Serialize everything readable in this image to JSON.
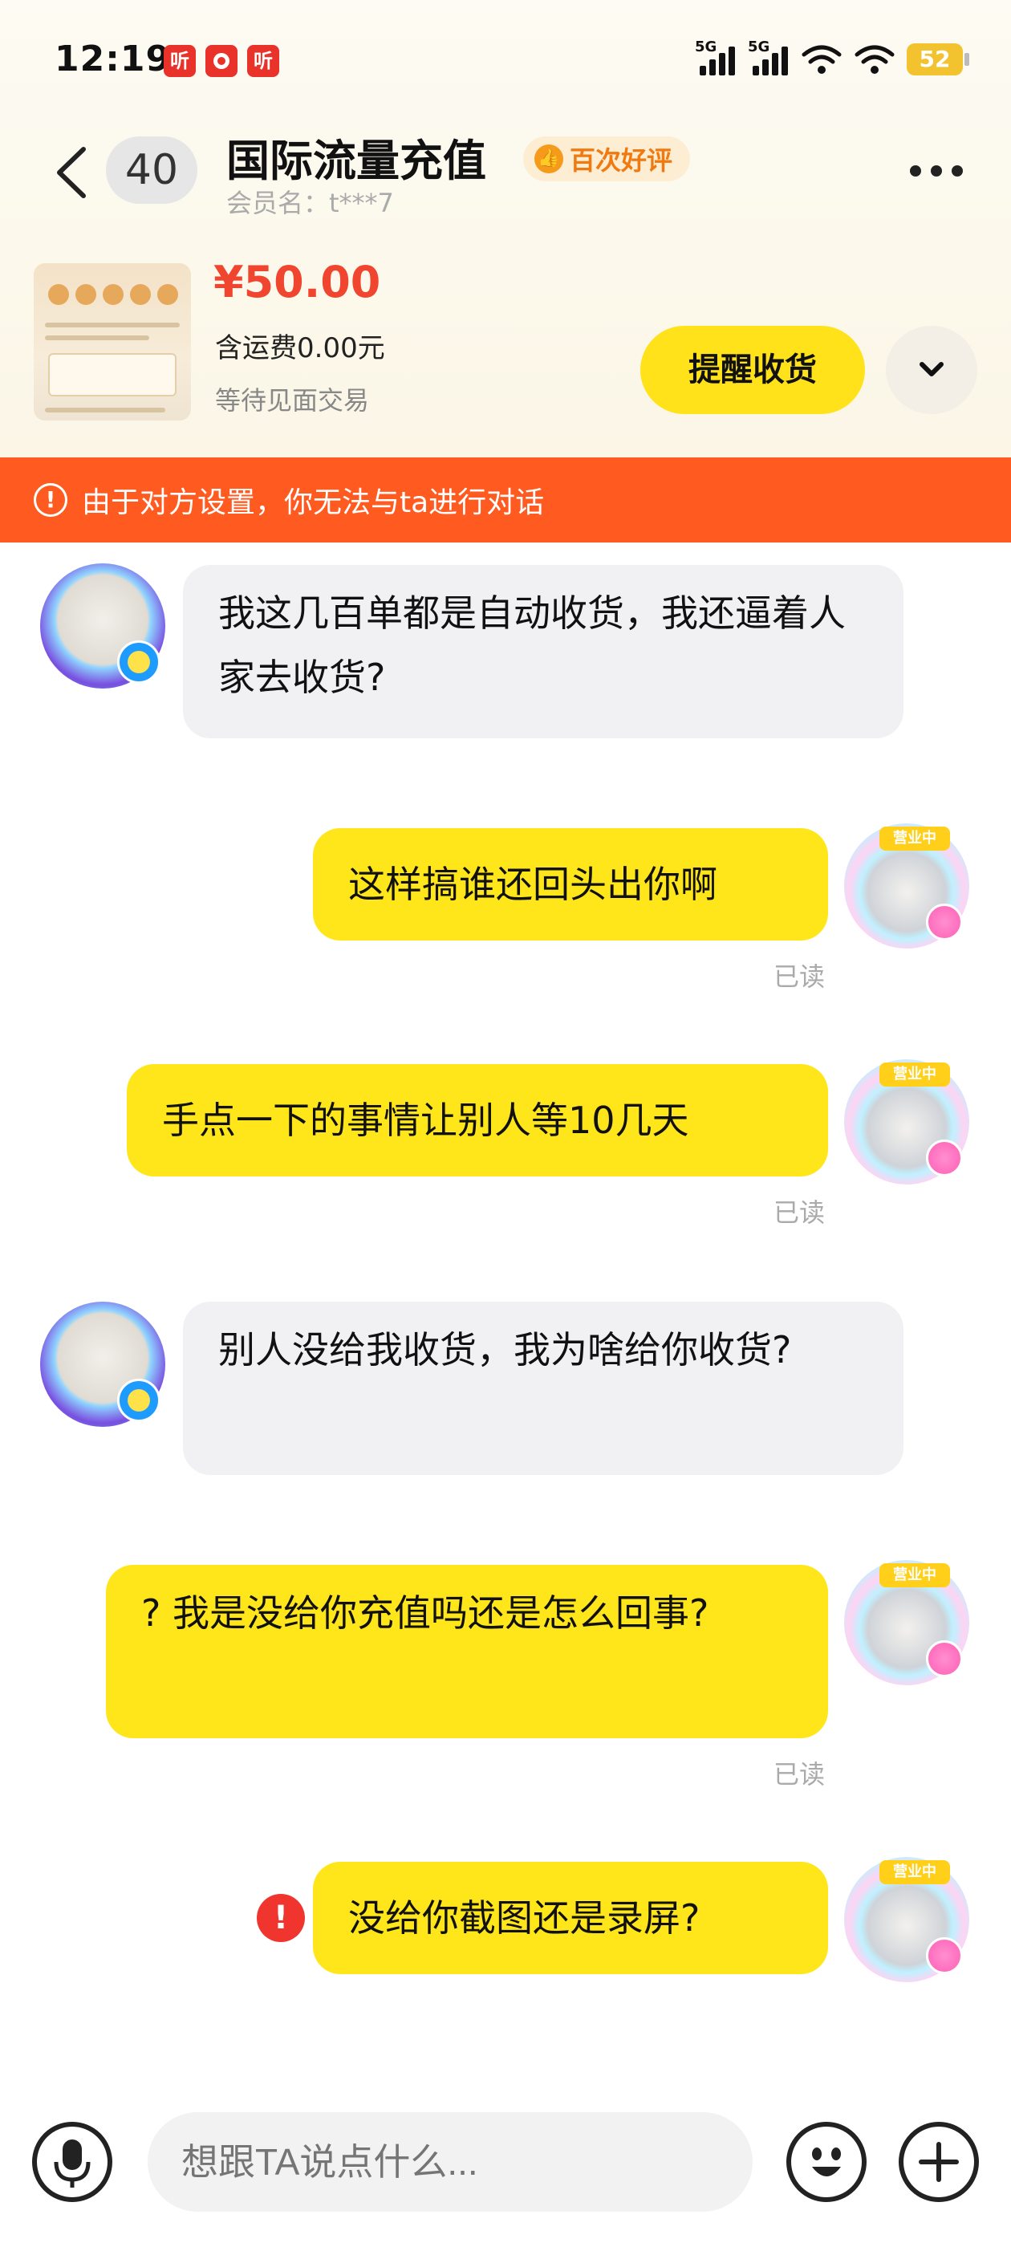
{
  "status_bar": {
    "time": "12:19",
    "notifications": [
      "听",
      "听"
    ],
    "signal_label_1": "5G",
    "signal_label_2": "5G",
    "battery": "52"
  },
  "header": {
    "count": "40",
    "title": "国际流量充值",
    "badge": "百次好评",
    "member": "会员名：t***7"
  },
  "order": {
    "price": "¥50.00",
    "shipping": "含运费0.00元",
    "status": "等待见面交易",
    "remind_label": "提醒收货"
  },
  "warning": {
    "text": "由于对方设置，你无法与ta进行对话"
  },
  "messages": [
    {
      "side": "left",
      "text": "我这几百单都是自动收货，我还逼着人家去收货?"
    },
    {
      "side": "right",
      "text": "这样搞谁还回头出你啊",
      "read": "已读"
    },
    {
      "side": "right",
      "text": "手点一下的事情让别人等10几天",
      "read": "已读"
    },
    {
      "side": "left",
      "text": "别人没给我收货，我为啥给你收货?"
    },
    {
      "side": "right",
      "text": "? 我是没给你充值吗还是怎么回事?",
      "read": "已读"
    },
    {
      "side": "right",
      "text": "没给你截图还是录屏?",
      "error": "!"
    }
  ],
  "avatar_tag": "营业中",
  "input": {
    "placeholder": "想跟TA说点什么..."
  },
  "colors": {
    "accent_yellow": "#ffe61a",
    "warning_orange": "#ff5a1f",
    "price_red": "#f0452e"
  }
}
